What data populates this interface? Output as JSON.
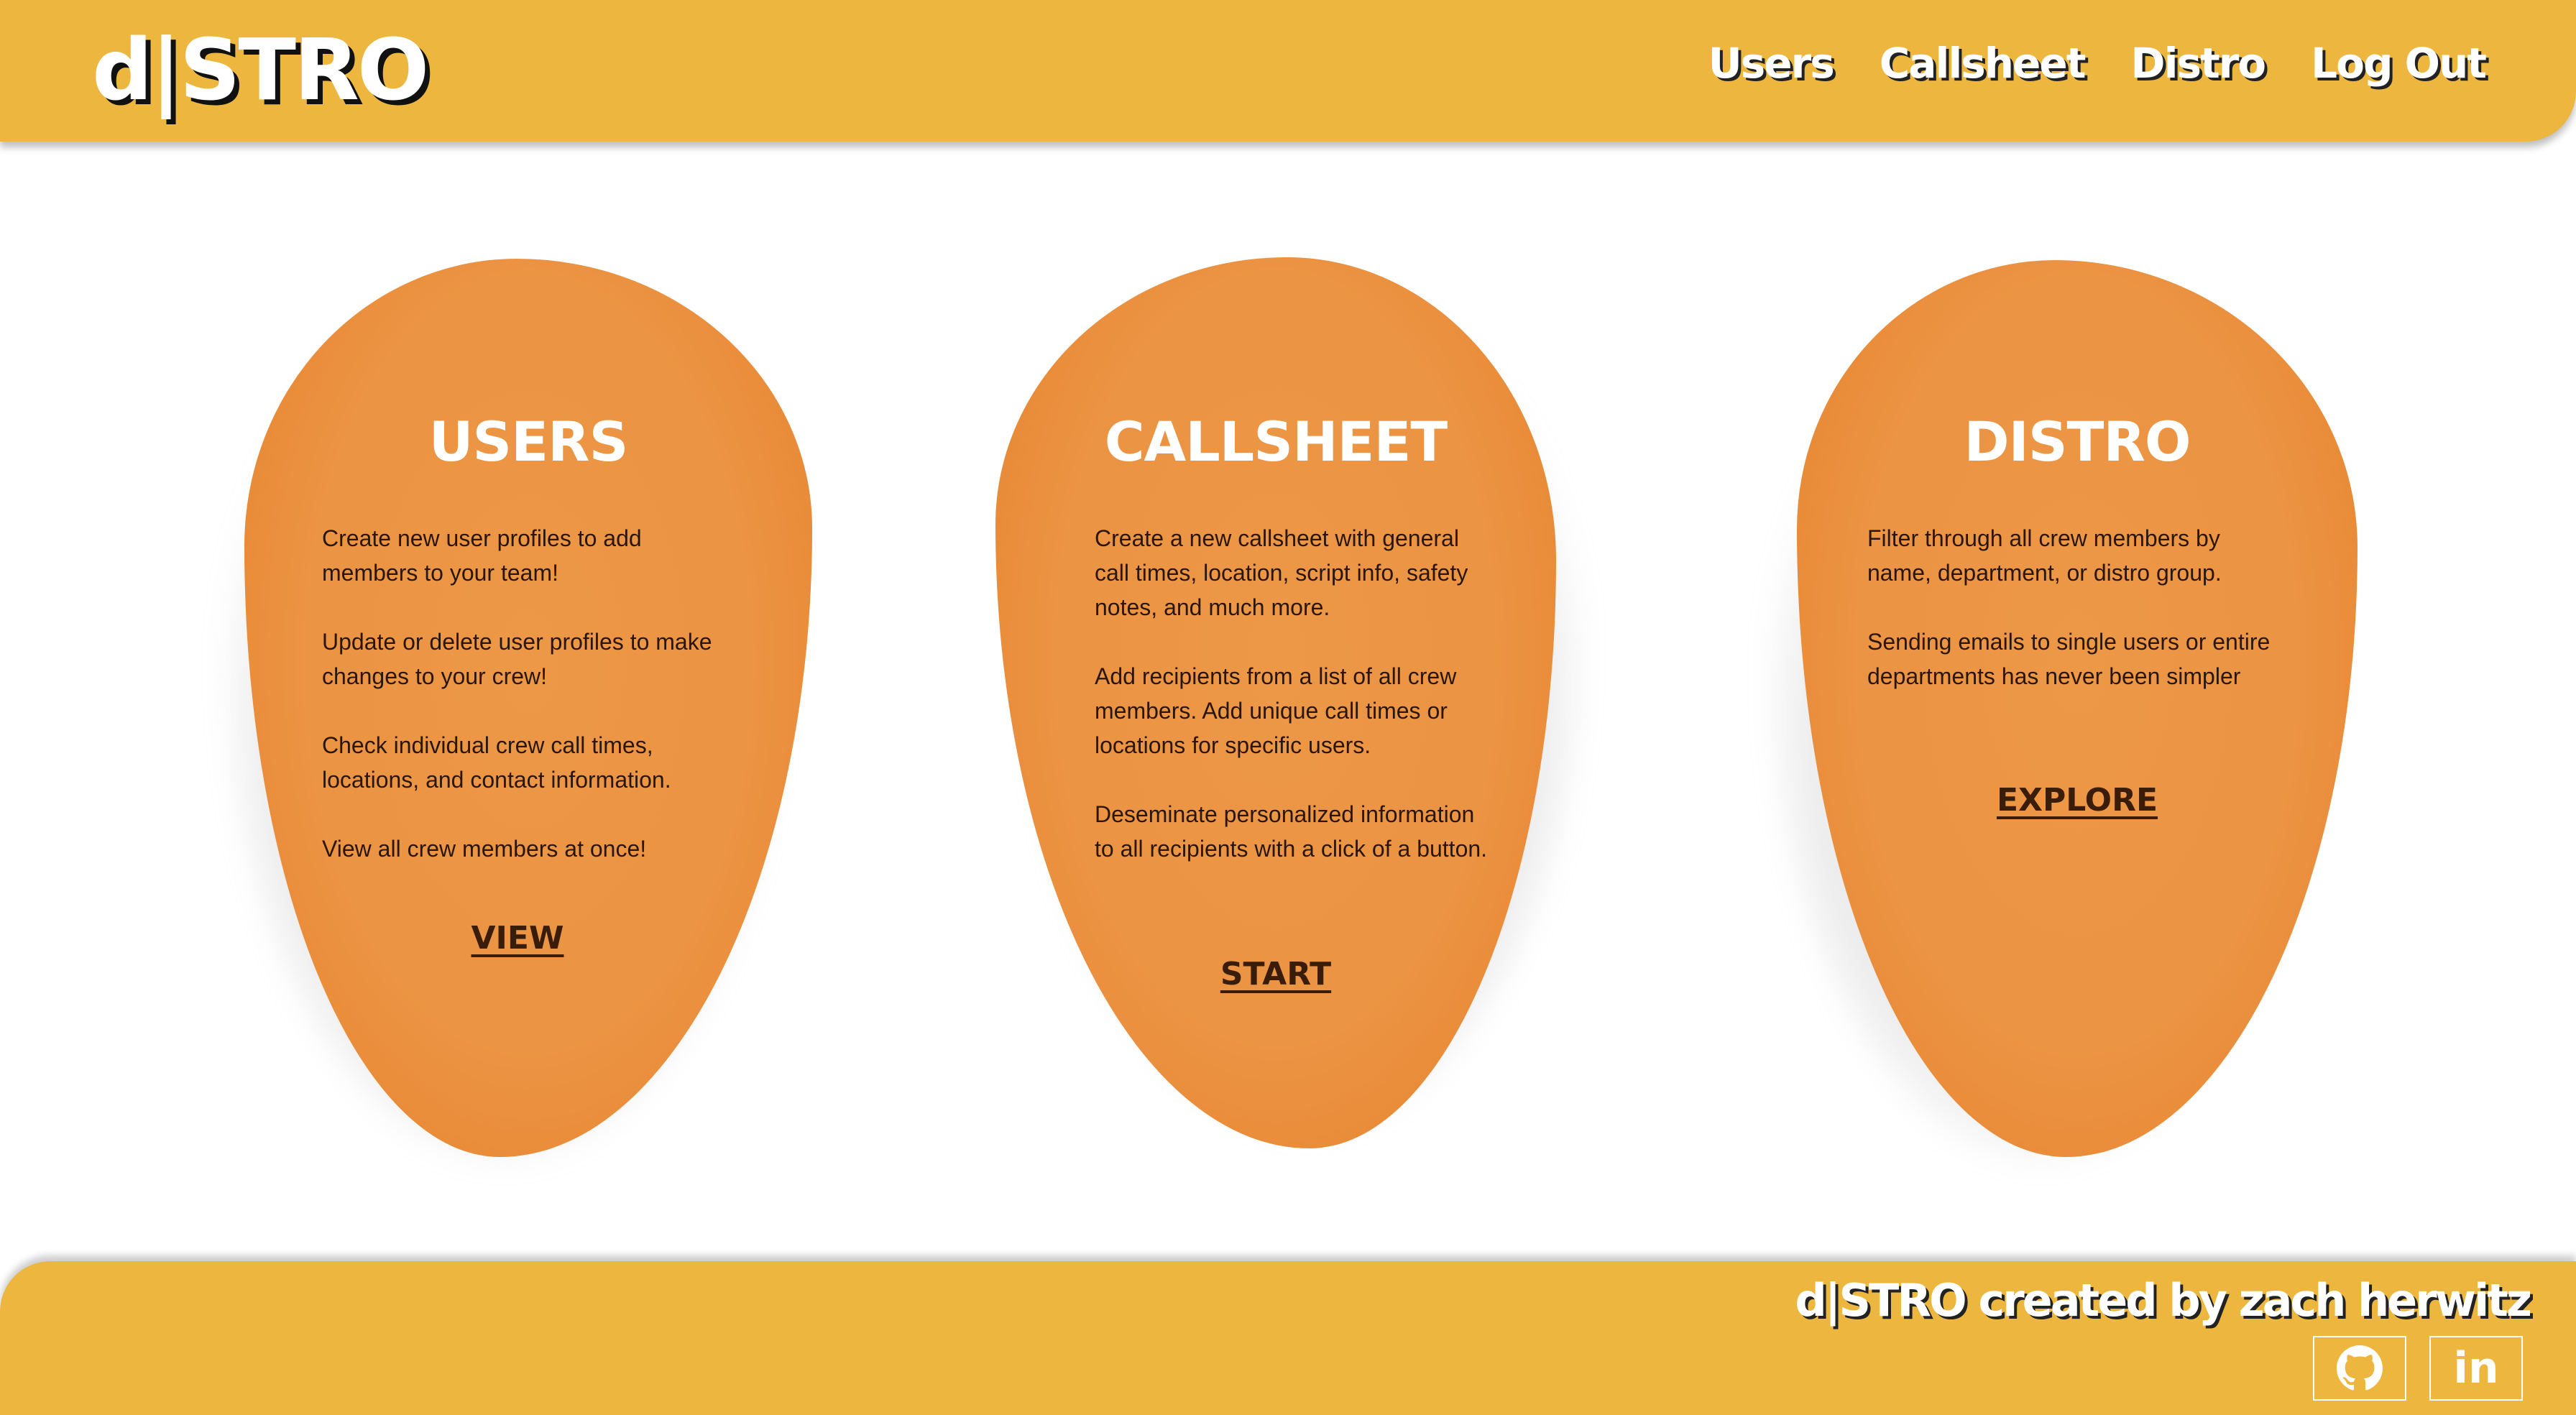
{
  "header": {
    "logo": "d|STRO",
    "nav": [
      "Users",
      "Callsheet",
      "Distro",
      "Log Out"
    ]
  },
  "cards": [
    {
      "title": "USERS",
      "paragraphs": [
        "Create new user profiles to add members to your team!",
        "Update or delete user profiles to make changes to your crew!",
        "Check individual crew call times, locations, and contact information.",
        "View all crew members at once!"
      ],
      "link": "VIEW"
    },
    {
      "title": "CALLSHEET",
      "paragraphs": [
        "Create a new callsheet with general call times, location, script info, safety notes, and much more.",
        "Add recipients from a list of all crew members. Add unique call times or locations for specific users.",
        "Deseminate personalized information to all recipients with a click of a button."
      ],
      "link": "START"
    },
    {
      "title": "DISTRO",
      "paragraphs": [
        "Filter through all crew members by name, department, or distro group.",
        "Sending emails to single users or entire departments has never been simpler"
      ],
      "link": "EXPLORE"
    }
  ],
  "footer": {
    "credit": "d|STRO created by zach herwitz",
    "social": [
      {
        "icon": "github-icon"
      },
      {
        "icon": "linkedin-icon",
        "glyph": "in"
      }
    ]
  },
  "colors": {
    "header_bg": "#ecb63f",
    "blob": "#eb9443",
    "blob_edge": "#e6802c",
    "link": "#3a1d08"
  }
}
